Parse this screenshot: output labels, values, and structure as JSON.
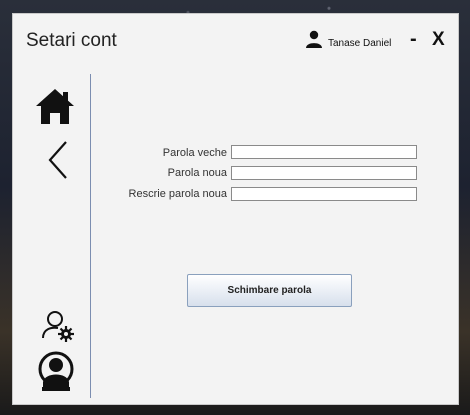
{
  "window": {
    "title": "Setari cont"
  },
  "header": {
    "user_name": "Tanase Daniel",
    "minimize_label": "-",
    "close_label": "X"
  },
  "sidebar": {
    "items": [
      {
        "icon": "home-icon"
      },
      {
        "icon": "back-arrow-icon"
      },
      {
        "icon": "user-settings-icon"
      },
      {
        "icon": "account-icon"
      }
    ]
  },
  "form": {
    "old_password_label": "Parola veche",
    "new_password_label": "Parola noua",
    "repeat_password_label": "Rescrie parola noua",
    "old_password_value": "",
    "new_password_value": "",
    "repeat_password_value": "",
    "submit_label": "Schimbare parola"
  },
  "colors": {
    "divider": "#7b8db0",
    "button_border": "#8aa0bd"
  }
}
